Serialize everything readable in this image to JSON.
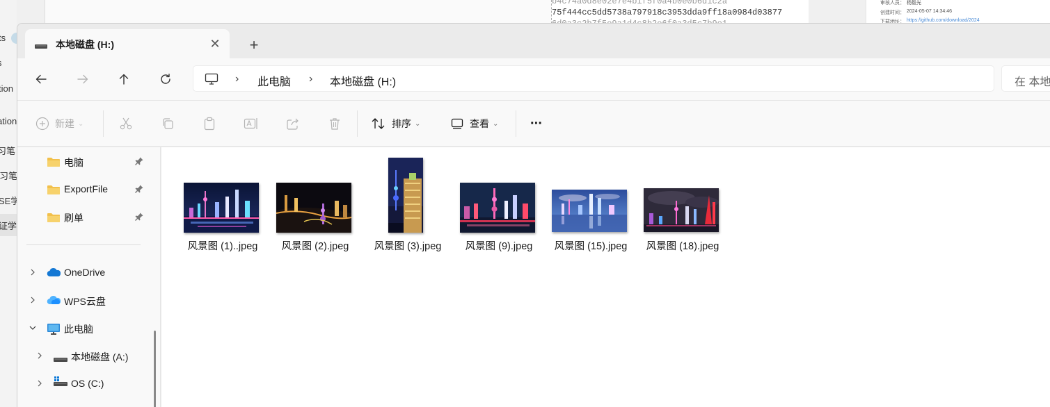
{
  "background": {
    "left_fragments": [
      "ts",
      "s",
      "tion",
      "ation",
      "习笔",
      "学习笔",
      "SE学",
      "证学"
    ],
    "hash_line": "75f444cc5dd5738a797918c3953dda9ff18a0984d03877",
    "meta_labels": [
      "审核人员：",
      "创建时间：",
      "下载地址："
    ],
    "meta_values": [
      "杨毅光",
      "2024-05-07 14:34:46",
      "https://github.com/download/2024"
    ]
  },
  "window": {
    "tab": {
      "title": "本地磁盘 (H:)",
      "close_glyph": "✕",
      "newtab_glyph": "+"
    },
    "breadcrumb": [
      "此电脑",
      "本地磁盘 (H:)"
    ],
    "search_placeholder": "在 本地",
    "toolbar": {
      "new_label": "新建",
      "sort_label": "排序",
      "view_label": "查看",
      "more_glyph": "···"
    },
    "sidebar": {
      "pinned": [
        {
          "label": "电脑",
          "icon": "folder-icon"
        },
        {
          "label": "ExportFile",
          "icon": "folder-icon"
        },
        {
          "label": "刷单",
          "icon": "folder-icon"
        }
      ],
      "tree": [
        {
          "label": "OneDrive",
          "icon": "onedrive-icon",
          "expanded": false
        },
        {
          "label": "WPS云盘",
          "icon": "wps-cloud-icon",
          "expanded": false
        },
        {
          "label": "此电脑",
          "icon": "this-pc-icon",
          "expanded": true
        },
        {
          "label": "本地磁盘 (A:)",
          "icon": "drive-icon",
          "expanded": false
        },
        {
          "label": "OS (C:)",
          "icon": "os-drive-icon",
          "expanded": false
        }
      ]
    },
    "files": [
      {
        "name": "风景图 (1)..jpeg",
        "orientation": "landscape"
      },
      {
        "name": "风景图 (2).jpeg",
        "orientation": "landscape"
      },
      {
        "name": "风景图 (3).jpeg",
        "orientation": "portrait"
      },
      {
        "name": "风景图 (9).jpeg",
        "orientation": "landscape"
      },
      {
        "name": "风景图 (15).jpeg",
        "orientation": "landscape"
      },
      {
        "name": "风景图 (18).jpeg",
        "orientation": "landscape"
      }
    ]
  }
}
